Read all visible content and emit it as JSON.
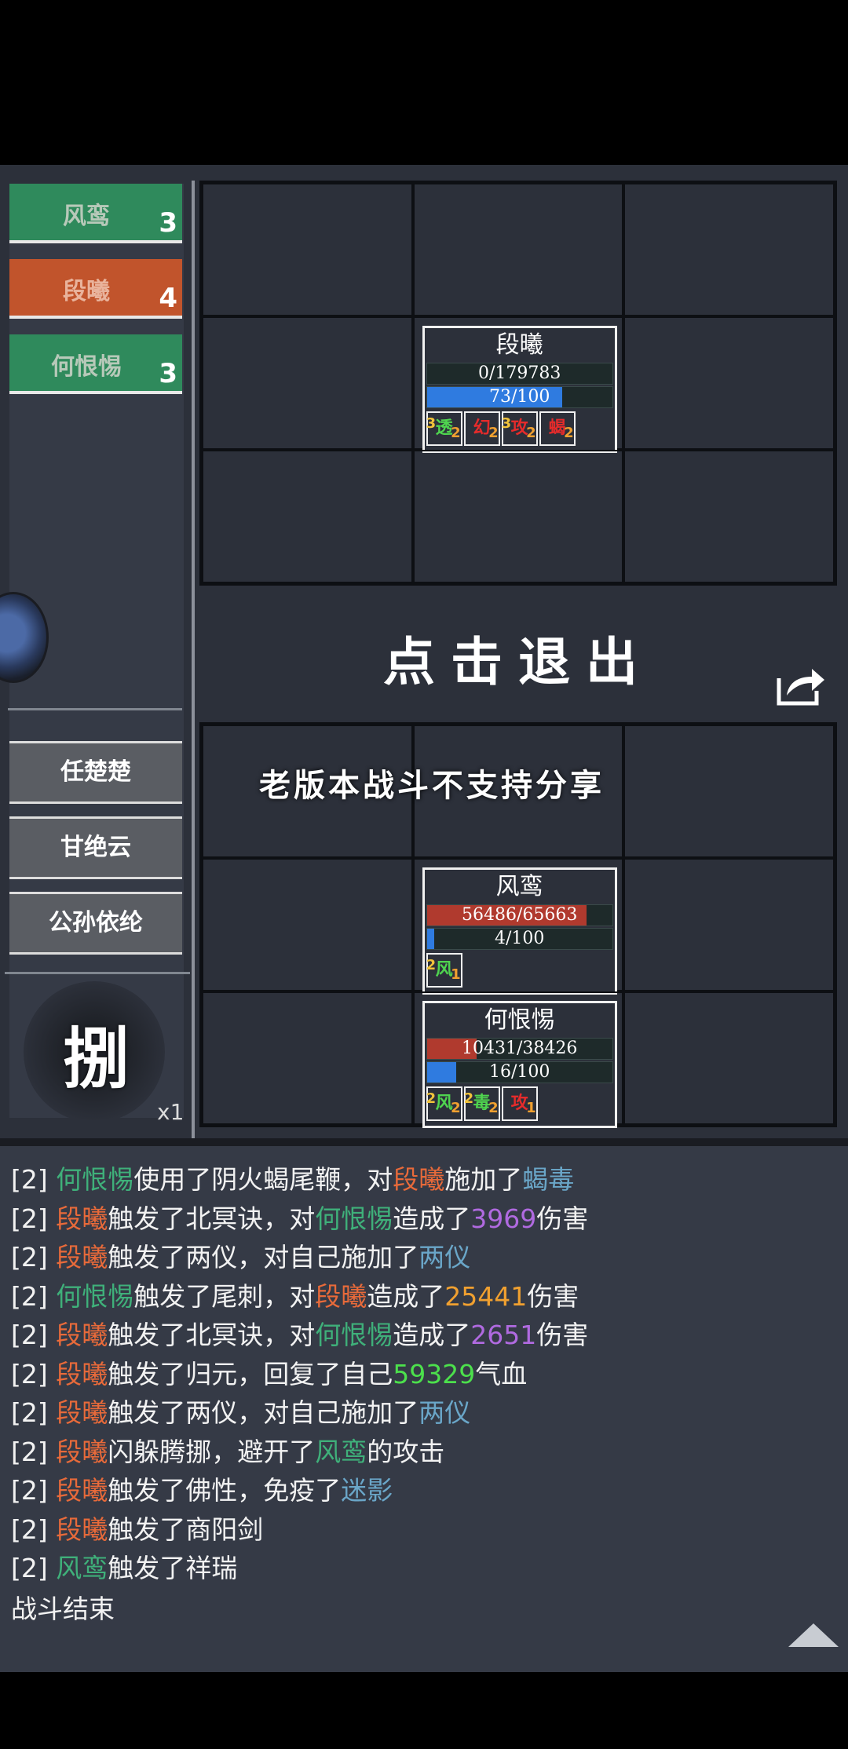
{
  "sidebar": {
    "units": [
      {
        "name": "风鸾",
        "count": "3",
        "color": "#2f8a5c"
      },
      {
        "name": "段曦",
        "count": "4",
        "color": "#c1542c"
      },
      {
        "name": "何恨惕",
        "count": "3",
        "color": "#2f8a5c"
      }
    ],
    "reserves": [
      "任楚楚",
      "甘绝云",
      "公孙依纶"
    ],
    "skill": {
      "glyph": "捌",
      "multiplier": "x1"
    }
  },
  "enemy": {
    "name": "段曦",
    "hp_text": "0/179783",
    "hp_fraction": 0,
    "mp_text": "73/100",
    "mp_fraction": 0.73,
    "statuses": [
      {
        "glyph": "透",
        "tl": "3",
        "br": "2",
        "color": "#4fd44f"
      },
      {
        "glyph": "幻",
        "tl": "",
        "br": "2",
        "color": "#e52b2b"
      },
      {
        "glyph": "攻",
        "tl": "3",
        "br": "2",
        "color": "#e52b2b"
      },
      {
        "glyph": "蝎",
        "tl": "",
        "br": "2",
        "color": "#e52b2b"
      }
    ]
  },
  "allies": [
    {
      "name": "风鸾",
      "hp_text": "56486/65663",
      "hp_fraction": 0.86,
      "mp_text": "4/100",
      "mp_fraction": 0.04,
      "statuses": [
        {
          "glyph": "风",
          "tl": "2",
          "br": "1",
          "color": "#4fd44f"
        }
      ]
    },
    {
      "name": "何恨惕",
      "hp_text": "10431/38426",
      "hp_fraction": 0.27,
      "mp_text": "16/100",
      "mp_fraction": 0.16,
      "statuses": [
        {
          "glyph": "风",
          "tl": "2",
          "br": "2",
          "color": "#4fd44f"
        },
        {
          "glyph": "毒",
          "tl": "2",
          "br": "2",
          "color": "#4fd44f"
        },
        {
          "glyph": "攻",
          "tl": "",
          "br": "1",
          "color": "#e52b2b"
        }
      ]
    }
  ],
  "exit_text": "点击退出",
  "share_note": "老版本战斗不支持分享",
  "log": [
    [
      {
        "t": "[2] ",
        "c": "white"
      },
      {
        "t": "何恨惕",
        "c": "green"
      },
      {
        "t": "使用了阴火蝎尾鞭，对",
        "c": "white"
      },
      {
        "t": "段曦",
        "c": "orange"
      },
      {
        "t": "施加了",
        "c": "white"
      },
      {
        "t": "蝎毒",
        "c": "teal"
      }
    ],
    [
      {
        "t": "[2] ",
        "c": "white"
      },
      {
        "t": "段曦",
        "c": "orange"
      },
      {
        "t": "触发了北冥诀，对",
        "c": "white"
      },
      {
        "t": "何恨惕",
        "c": "green"
      },
      {
        "t": "造成了",
        "c": "white"
      },
      {
        "t": "3969",
        "c": "purple"
      },
      {
        "t": "伤害",
        "c": "white"
      }
    ],
    [
      {
        "t": "[2] ",
        "c": "white"
      },
      {
        "t": "段曦",
        "c": "orange"
      },
      {
        "t": "触发了两仪，对自己施加了",
        "c": "white"
      },
      {
        "t": "两仪",
        "c": "teal"
      }
    ],
    [
      {
        "t": "[2] ",
        "c": "white"
      },
      {
        "t": "何恨惕",
        "c": "green"
      },
      {
        "t": "触发了尾刺，对",
        "c": "white"
      },
      {
        "t": "段曦",
        "c": "orange"
      },
      {
        "t": "造成了",
        "c": "white"
      },
      {
        "t": "25441",
        "c": "gold"
      },
      {
        "t": "伤害",
        "c": "white"
      }
    ],
    [
      {
        "t": "[2] ",
        "c": "white"
      },
      {
        "t": "段曦",
        "c": "orange"
      },
      {
        "t": "触发了北冥诀，对",
        "c": "white"
      },
      {
        "t": "何恨惕",
        "c": "green"
      },
      {
        "t": "造成了",
        "c": "white"
      },
      {
        "t": "2651",
        "c": "purple"
      },
      {
        "t": "伤害",
        "c": "white"
      }
    ],
    [
      {
        "t": "[2] ",
        "c": "white"
      },
      {
        "t": "段曦",
        "c": "orange"
      },
      {
        "t": "触发了归元，回复了自己",
        "c": "white"
      },
      {
        "t": "59329",
        "c": "lime"
      },
      {
        "t": "气血",
        "c": "white"
      }
    ],
    [
      {
        "t": "[2] ",
        "c": "white"
      },
      {
        "t": "段曦",
        "c": "orange"
      },
      {
        "t": "触发了两仪，对自己施加了",
        "c": "white"
      },
      {
        "t": "两仪",
        "c": "teal"
      }
    ],
    [
      {
        "t": "[2] ",
        "c": "white"
      },
      {
        "t": "段曦",
        "c": "orange"
      },
      {
        "t": "闪躲腾挪，避开了",
        "c": "white"
      },
      {
        "t": "风鸾",
        "c": "green"
      },
      {
        "t": "的攻击",
        "c": "white"
      }
    ],
    [
      {
        "t": "[2] ",
        "c": "white"
      },
      {
        "t": "段曦",
        "c": "orange"
      },
      {
        "t": "触发了佛性，免疫了",
        "c": "white"
      },
      {
        "t": "迷影",
        "c": "teal"
      }
    ],
    [
      {
        "t": "[2] ",
        "c": "white"
      },
      {
        "t": "段曦",
        "c": "orange"
      },
      {
        "t": "触发了商阳剑",
        "c": "white"
      }
    ],
    [
      {
        "t": "[2] ",
        "c": "white"
      },
      {
        "t": "风鸾",
        "c": "green"
      },
      {
        "t": "触发了祥瑞",
        "c": "white"
      }
    ]
  ],
  "log_end": "战斗结束"
}
